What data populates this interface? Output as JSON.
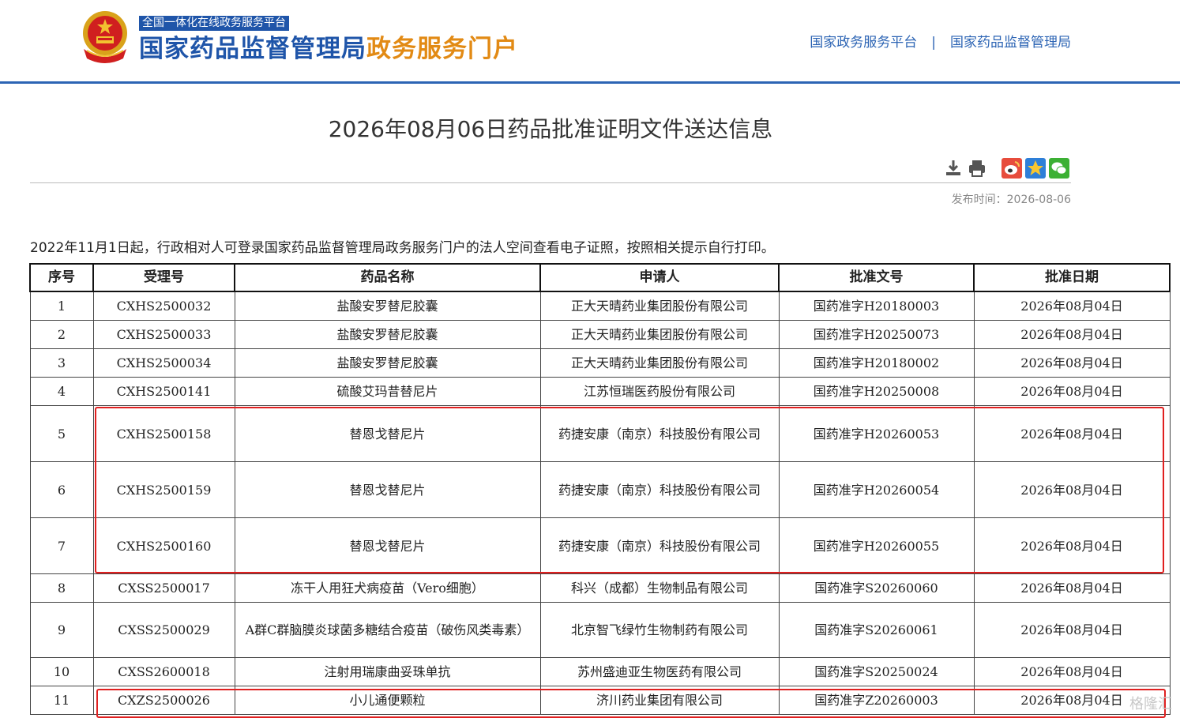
{
  "header": {
    "platform_tag": "全国一体化在线政务服务平台",
    "title_main": "国家药品监督管理局",
    "title_accent": "政务服务门户",
    "links": [
      "国家政务服务平台",
      "国家药品监督管理局"
    ],
    "link_separator": "|"
  },
  "article": {
    "title": "2026年08月06日药品批准证明文件送达信息",
    "pubtime_label": "发布时间：",
    "pubtime_value": "2026-08-06",
    "notice": "2022年11月1日起，行政相对人可登录国家药品监督管理局政务服务门户的法人空间查看电子证照，按照相关提示自行打印。"
  },
  "tools": [
    "download-icon",
    "print-icon",
    "weibo-icon",
    "qzone-icon",
    "wechat-icon"
  ],
  "table": {
    "headers": [
      "序号",
      "受理号",
      "药品名称",
      "申请人",
      "批准文号",
      "批准日期"
    ],
    "rows": [
      [
        "1",
        "CXHS2500032",
        "盐酸安罗替尼胶囊",
        "正大天晴药业集团股份有限公司",
        "国药准字H20180003",
        "2026年08月04日"
      ],
      [
        "2",
        "CXHS2500033",
        "盐酸安罗替尼胶囊",
        "正大天晴药业集团股份有限公司",
        "国药准字H20250073",
        "2026年08月04日"
      ],
      [
        "3",
        "CXHS2500034",
        "盐酸安罗替尼胶囊",
        "正大天晴药业集团股份有限公司",
        "国药准字H20180002",
        "2026年08月04日"
      ],
      [
        "4",
        "CXHS2500141",
        "硫酸艾玛昔替尼片",
        "江苏恒瑞医药股份有限公司",
        "国药准字H20250008",
        "2026年08月04日"
      ],
      [
        "5",
        "CXHS2500158",
        "替恩戈替尼片",
        "药捷安康（南京）科技股份有限公司",
        "国药准字H20260053",
        "2026年08月04日"
      ],
      [
        "6",
        "CXHS2500159",
        "替恩戈替尼片",
        "药捷安康（南京）科技股份有限公司",
        "国药准字H20260054",
        "2026年08月04日"
      ],
      [
        "7",
        "CXHS2500160",
        "替恩戈替尼片",
        "药捷安康（南京）科技股份有限公司",
        "国药准字H20260055",
        "2026年08月04日"
      ],
      [
        "8",
        "CXSS2500017",
        "冻干人用狂犬病疫苗（Vero细胞）",
        "科兴（成都）生物制品有限公司",
        "国药准字S20260060",
        "2026年08月04日"
      ],
      [
        "9",
        "CXSS2500029",
        "A群C群脑膜炎球菌多糖结合疫苗（破伤风类毒素）",
        "北京智飞绿竹生物制药有限公司",
        "国药准字S20260061",
        "2026年08月04日"
      ],
      [
        "10",
        "CXSS2600018",
        "注射用瑞康曲妥珠单抗",
        "苏州盛迪亚生物医药有限公司",
        "国药准字S20250024",
        "2026年08月04日"
      ],
      [
        "11",
        "CXZS2500026",
        "小儿通便颗粒",
        "济川药业集团有限公司",
        "国药准字Z20260003",
        "2026年08月04日"
      ]
    ]
  },
  "watermark": "格隆汇",
  "colors": {
    "brand_blue": "#1f55a9",
    "accent_orange": "#e28a14",
    "highlight_red": "#e02020"
  }
}
